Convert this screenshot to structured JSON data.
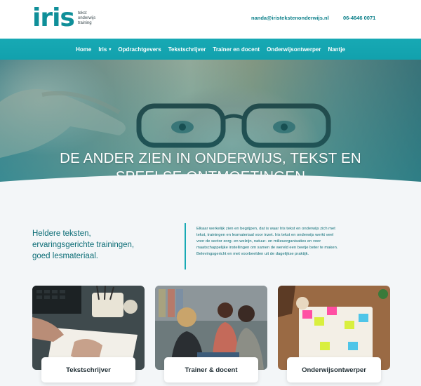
{
  "header": {
    "logo_word": "iris",
    "logo_tagline": [
      "tekst",
      "onderwijs",
      "training"
    ],
    "email": "nanda@iristekstenonderwijs.nl",
    "phone": "06-4646 0071"
  },
  "nav": {
    "items": [
      {
        "label": "Home"
      },
      {
        "label": "Iris",
        "has_dropdown": true
      },
      {
        "label": "Opdrachtgevers"
      },
      {
        "label": "Tekstschrijver"
      },
      {
        "label": "Trainer en docent"
      },
      {
        "label": "Onderwijsontwerper"
      },
      {
        "label": "Nantje"
      }
    ]
  },
  "hero": {
    "title_line1": "DE ANDER ZIEN IN ONDERWIJS, TEKST EN",
    "title_line2": "SPEELSE ONTMOETINGEN"
  },
  "intro": {
    "lead": [
      "Heldere teksten,",
      "ervaringsgerichte trainingen,",
      "goed lesmateriaal."
    ],
    "body": [
      "Elkaar werkelijk zien en begrijpen, dat is waar Iris tekst en onderwijs  zich met",
      "tekst, trainingen en lesmateriaal voor inzet. Iris tekst en onderwijs werkt veel",
      "voor de sector zorg- en welzijn, natuur- en milieuorganisaties en voor",
      "maatschappelijke instellingen om samen de wereld een beetje beter te maken.",
      "Belevingsgericht en met voorbeelden uit de dagelijkse praktijk."
    ]
  },
  "cards": [
    {
      "label": "Tekstschrijver"
    },
    {
      "label": "Trainer & docent"
    },
    {
      "label": "Onderwijsontwerper"
    }
  ],
  "colors": {
    "brand_teal": "#17a9b4",
    "dark_teal": "#0c6d76",
    "nav_text": "#ffffff",
    "page_bg": "#f3f6f8"
  }
}
